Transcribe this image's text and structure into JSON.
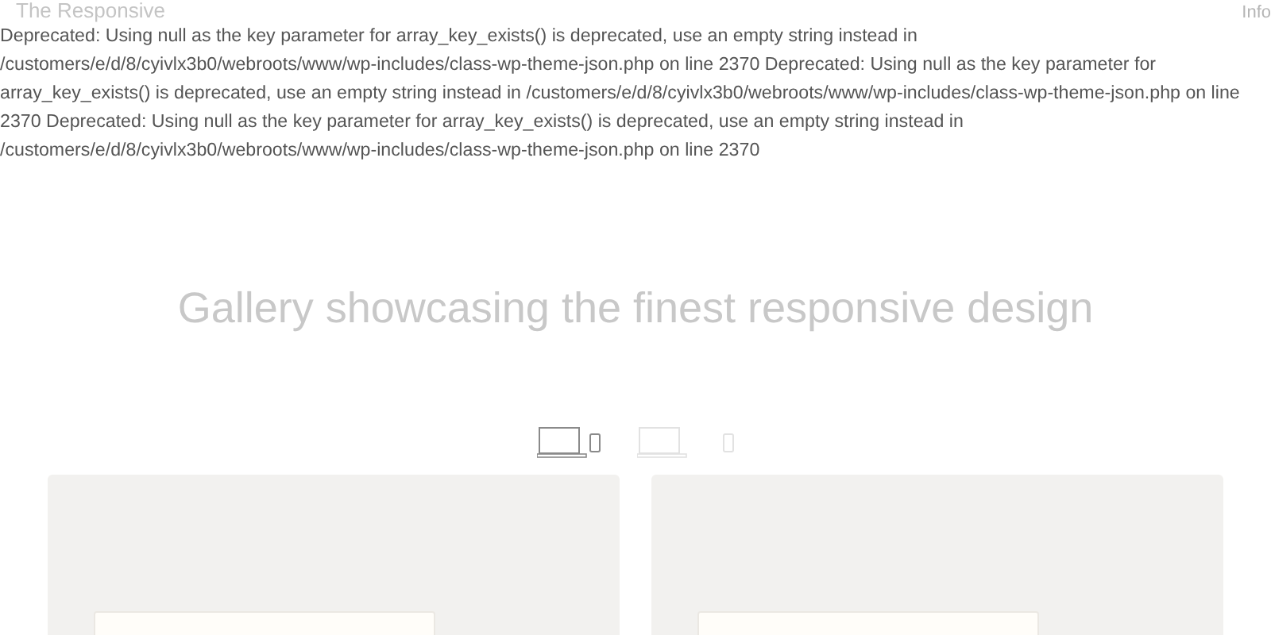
{
  "header": {
    "logo": "The Responsive",
    "menu_link": "Info"
  },
  "error_message": "Deprecated: Using null as the key parameter for array_key_exists() is deprecated, use an empty string instead in /customers/e/d/8/cyivlx3b0/webroots/www/wp-includes/class-wp-theme-json.php on line 2370 Deprecated: Using null as the key parameter for array_key_exists() is deprecated, use an empty string instead in /customers/e/d/8/cyivlx3b0/webroots/www/wp-includes/class-wp-theme-json.php on line 2370 Deprecated: Using null as the key parameter for array_key_exists() is deprecated, use an empty string instead in /customers/e/d/8/cyivlx3b0/webroots/www/wp-includes/class-wp-theme-json.php on line 2370",
  "headline": "Gallery showcasing the finest responsive design",
  "device_filters": [
    {
      "kind": "all",
      "selected": true
    },
    {
      "kind": "laptop",
      "selected": false
    },
    {
      "kind": "phone",
      "selected": false
    }
  ],
  "gallery": [
    {
      "kind": "preview"
    },
    {
      "kind": "preview"
    }
  ]
}
